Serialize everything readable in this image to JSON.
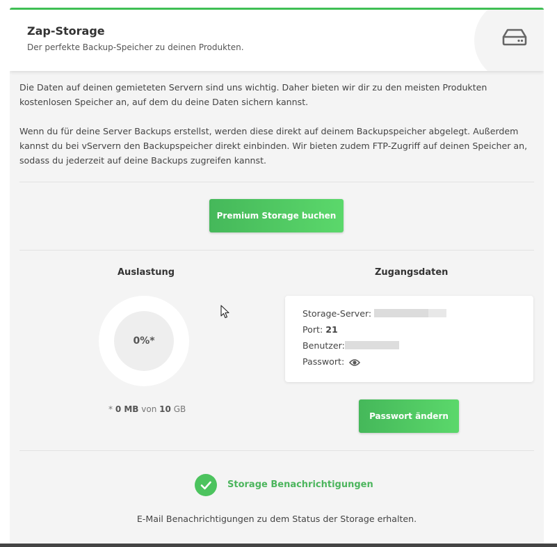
{
  "header": {
    "title": "Zap-Storage",
    "subtitle": "Der perfekte Backup-Speicher zu deinen Produkten.",
    "icon": "hard-drive-icon"
  },
  "intro": {
    "paragraph1": "Die Daten auf deinen gemieteten Servern sind uns wichtig. Daher bieten wir dir zu den meisten Produkten kostenlosen Speicher an, auf dem du deine Daten sichern kannst.",
    "paragraph2": "Wenn du für deine Server Backups erstellst, werden diese direkt auf deinem Backupspeicher abgelegt. Außerdem kannst du bei vServern den Backupspeicher direkt einbinden. Wir bieten zudem FTP-Zugriff auf deinen Speicher an, sodass du jederzeit auf deine Backups zugreifen kannst."
  },
  "premium_button": "Premium Storage buchen",
  "usage": {
    "heading": "Auslastung",
    "percent_label": "0%*",
    "percent_value": 0,
    "note_prefix": "* ",
    "used": "0 MB",
    "of": "von",
    "total": "10",
    "unit": "GB"
  },
  "credentials": {
    "heading": "Zugangsdaten",
    "server_label": "Storage-Server:",
    "port_label": "Port:",
    "port_value": "21",
    "user_label": "Benutzer:",
    "password_label": "Passwort:",
    "change_password_button": "Passwort ändern"
  },
  "notifications": {
    "label": "Storage Benachrichtigungen",
    "description": "E-Mail Benachrichtigungen zu dem Status der Storage erhalten.",
    "enabled": true
  },
  "colors": {
    "accent": "#3fbf54",
    "button_start": "#45b85a",
    "button_end": "#5bd86b"
  }
}
